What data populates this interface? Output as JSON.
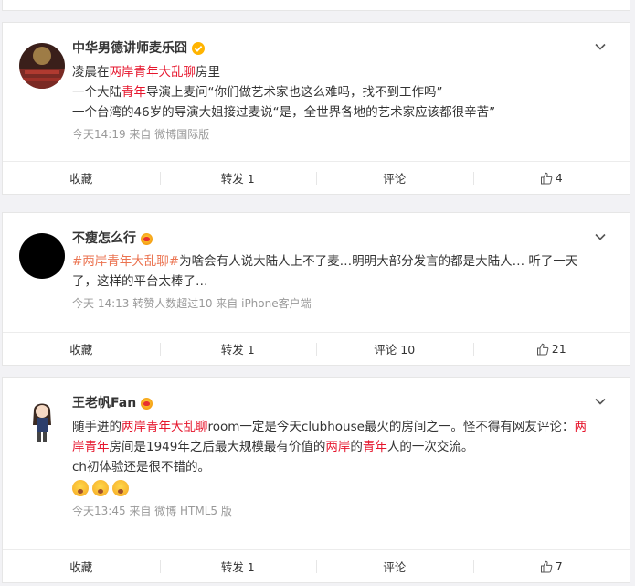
{
  "posts": [
    {
      "author": "中华男德讲师麦乐囧",
      "text_parts": [
        [
          "凌晨在",
          "",
          ""
        ],
        [
          "两岸青年大乱聊",
          "red",
          ""
        ],
        [
          "房里",
          "",
          ""
        ]
      ],
      "lines": [
        "凌晨在两岸青年大乱聊房里",
        "一个大陆青年导演上麦问“你们做艺术家也这么难吗，找不到工作吗”",
        "一个台湾的46岁的导演大姐接过麦说“是，全世界各地的艺术家应该都很辛苦”"
      ],
      "meta": "今天14:19  来自 微博国际版",
      "actions": {
        "collect": "收藏",
        "repost": "转发 1",
        "comment": "评论",
        "like": "4"
      }
    },
    {
      "author": "不瘦怎么行",
      "lines": [
        "#两岸青年大乱聊#为啥会有人说大陆人上不了麦…明明大部分发言的都是大陆人… 听了一天",
        "了，这样的平台太棒了…"
      ],
      "meta": "今天 14:13 转赞人数超过10  来自 iPhone客户端",
      "actions": {
        "collect": "收藏",
        "repost": "转发 1",
        "comment": "评论 10",
        "like": "21"
      }
    },
    {
      "author": "王老帆Fan",
      "lines": [
        "随手进的两岸青年大乱聊room一定是今天clubhouse最火的房间之一。怪不得有网友评论：两",
        "岸青年房间是1949年之后最大规模最有价值的两岸的青年人的一次交流。",
        "ch初体验还是很不错的。"
      ],
      "meta": "今天13:45  来自 微博 HTML5 版",
      "actions": {
        "collect": "收藏",
        "repost": "转发 1",
        "comment": "评论",
        "like": "7"
      }
    }
  ],
  "seg": {
    "p1l1a": "凌晨在",
    "p1l1b": "两岸青年大乱聊",
    "p1l1c": "房里",
    "p1l2a": "一个大陆",
    "p1l2b": "青年",
    "p1l2c": "导演上麦问“你们做艺术家也这么难吗，找不到工作吗”",
    "p1l3": "一个台湾的46岁的导演大姐接过麦说“是，全世界各地的艺术家应该都很辛苦”",
    "p2l1a": "#两岸青年大乱聊#",
    "p2l1b": "为啥会有人说大陆人上不了麦…明明大部分发言的都是大陆人… 听了一天",
    "p2l2": "了，这样的平台太棒了…",
    "p3l1a": "随手进的",
    "p3l1b": "两岸青年大乱聊",
    "p3l1c": "room一定是今天clubhouse最火的房间之一。怪不得有网友评论：",
    "p3l1d": "两",
    "p3l2a": "岸青年",
    "p3l2b": "房间是1949年之后最大规模最有价值的",
    "p3l2c": "两岸",
    "p3l2d": "的",
    "p3l2e": "青年",
    "p3l2f": "人的一次交流。",
    "p3l3": "ch初体验还是很不错的。"
  },
  "colors": {
    "highlight": "#e6162d",
    "topic": "#eb7350",
    "verified": "#ffb400"
  }
}
